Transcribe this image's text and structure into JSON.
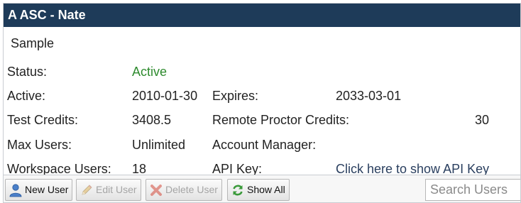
{
  "panel": {
    "title": "A ASC - Nate",
    "description": "Sample"
  },
  "fields": {
    "status_label": "Status:",
    "status_value": "Active",
    "active_label": "Active:",
    "active_value": "2010-01-30",
    "expires_label": "Expires:",
    "expires_value": "2033-03-01",
    "test_credits_label": "Test Credits:",
    "test_credits_value": "3408.5",
    "remote_proctor_label": "Remote Proctor Credits:",
    "remote_proctor_value": "30",
    "max_users_label": "Max Users:",
    "max_users_value": "Unlimited",
    "account_manager_label": "Account Manager:",
    "workspace_users_label": "Workspace Users:",
    "workspace_users_value": "18",
    "api_key_label": "API Key:",
    "api_key_link": "Click here to show API Key"
  },
  "toolbar": {
    "new_user": "New User",
    "edit_user": "Edit User",
    "delete_user": "Delete User",
    "show_all": "Show All",
    "search_placeholder": "Search Users"
  },
  "colors": {
    "titlebar": "#1e3b59",
    "status_active": "#2e8b2e",
    "link": "#2a3f5f"
  },
  "icons": [
    "user-icon",
    "pencil-icon",
    "delete-x-icon",
    "refresh-icon"
  ]
}
